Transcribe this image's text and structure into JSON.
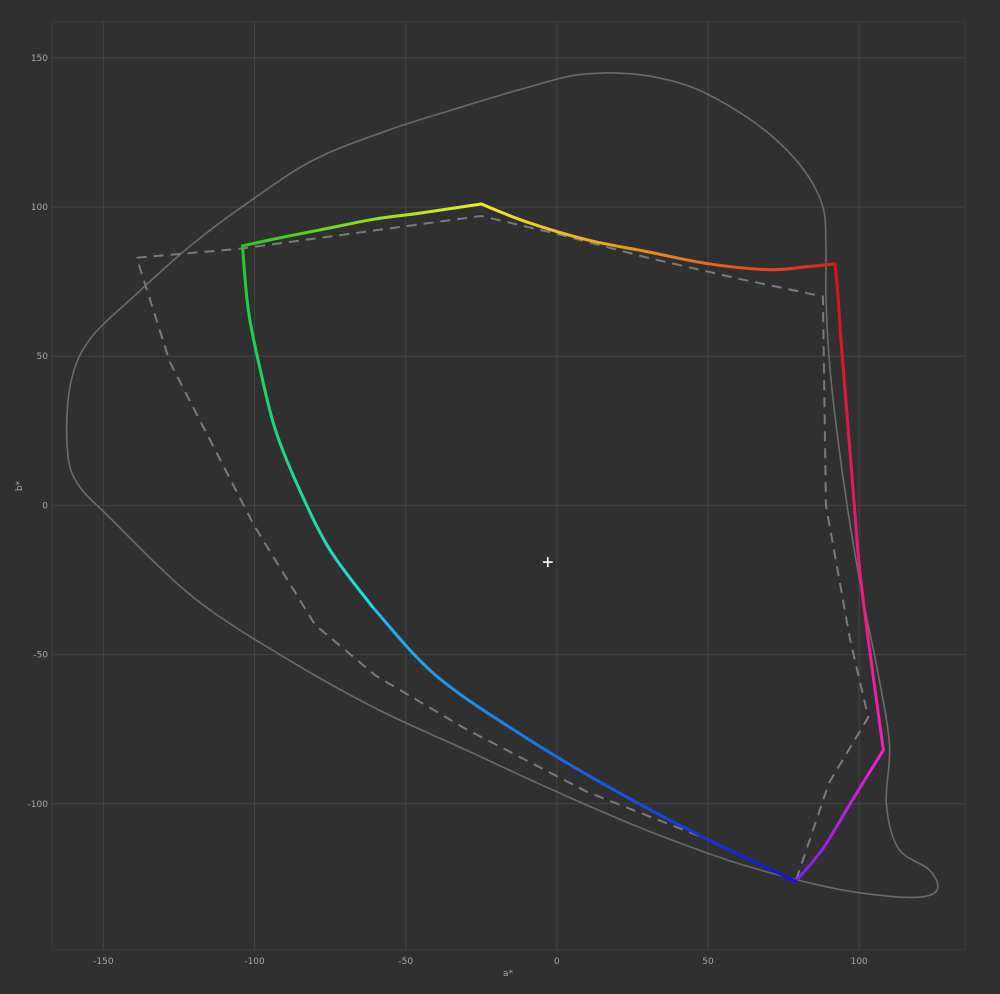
{
  "chart_data": {
    "type": "line",
    "xlabel": "a*",
    "ylabel": "b*",
    "xlim": [
      -167,
      135
    ],
    "ylim": [
      -149,
      162
    ],
    "xticks": [
      -150,
      -100,
      -50,
      0,
      50,
      100
    ],
    "yticks": [
      -100,
      -50,
      0,
      50,
      100,
      150
    ],
    "grid": true,
    "series": [
      {
        "style": "solid-thin-gray",
        "color": "#6b6b6b",
        "closed": true,
        "points": [
          [
            17,
            145
          ],
          [
            30,
            144
          ],
          [
            45,
            140
          ],
          [
            60,
            132
          ],
          [
            72,
            123
          ],
          [
            82,
            112
          ],
          [
            88,
            100
          ],
          [
            89,
            87
          ],
          [
            89,
            70
          ],
          [
            90,
            50
          ],
          [
            92,
            30
          ],
          [
            96,
            0
          ],
          [
            101,
            -30
          ],
          [
            106,
            -55
          ],
          [
            110,
            -80
          ],
          [
            109,
            -100
          ],
          [
            113,
            -115
          ],
          [
            123,
            -122
          ],
          [
            126,
            -128
          ],
          [
            122,
            -131
          ],
          [
            110,
            -131
          ],
          [
            90,
            -128
          ],
          [
            60,
            -120
          ],
          [
            30,
            -109
          ],
          [
            0,
            -96
          ],
          [
            -30,
            -82
          ],
          [
            -60,
            -68
          ],
          [
            -90,
            -51
          ],
          [
            -120,
            -31
          ],
          [
            -148,
            -4
          ],
          [
            -159,
            8
          ],
          [
            -162,
            20
          ],
          [
            -161,
            40
          ],
          [
            -155,
            55
          ],
          [
            -140,
            70
          ],
          [
            -120,
            88
          ],
          [
            -100,
            103
          ],
          [
            -80,
            116
          ],
          [
            -55,
            126
          ],
          [
            -30,
            134
          ],
          [
            -10,
            140
          ],
          [
            5,
            144
          ],
          [
            17,
            145
          ]
        ]
      },
      {
        "style": "dashed-gray",
        "color": "#7a7a7a",
        "closed": true,
        "points": [
          [
            -139,
            83
          ],
          [
            -105,
            86
          ],
          [
            -25,
            97
          ],
          [
            0,
            91
          ],
          [
            30,
            83
          ],
          [
            60,
            76
          ],
          [
            88,
            70
          ],
          [
            89,
            0
          ],
          [
            97,
            -45
          ],
          [
            103,
            -71
          ],
          [
            90,
            -93
          ],
          [
            79,
            -126
          ],
          [
            50,
            -112
          ],
          [
            10,
            -96
          ],
          [
            -30,
            -75
          ],
          [
            -60,
            -57
          ],
          [
            -80,
            -40
          ],
          [
            -100,
            -7
          ],
          [
            -128,
            48
          ],
          [
            -139,
            83
          ]
        ]
      },
      {
        "style": "solid-gradient",
        "closed": true,
        "segments": [
          {
            "from": "#22cc22",
            "to": "#eeee22",
            "points": [
              [
                -104,
                87
              ],
              [
                -90,
                90
              ],
              [
                -75,
                93
              ],
              [
                -60,
                96
              ],
              [
                -45,
                98
              ],
              [
                -25,
                101
              ]
            ]
          },
          {
            "from": "#eeee22",
            "to": "#dd2222",
            "points": [
              [
                -25,
                101
              ],
              [
                -10,
                95
              ],
              [
                10,
                89
              ],
              [
                30,
                85
              ],
              [
                50,
                81
              ],
              [
                70,
                79
              ],
              [
                83,
                80
              ],
              [
                92,
                81
              ]
            ]
          },
          {
            "from": "#dd1111",
            "to": "#ee22bb",
            "points": [
              [
                92,
                81
              ],
              [
                93,
                70
              ],
              [
                94,
                55
              ],
              [
                96,
                30
              ],
              [
                98,
                5
              ],
              [
                100,
                -20
              ],
              [
                103,
                -45
              ],
              [
                108,
                -82
              ]
            ]
          },
          {
            "from": "#ee22cc",
            "to": "#7722ee",
            "points": [
              [
                108,
                -82
              ],
              [
                97,
                -100
              ],
              [
                88,
                -115
              ],
              [
                79,
                -126
              ]
            ]
          },
          {
            "from": "#1111dd",
            "to": "#22bbee",
            "points": [
              [
                79,
                -126
              ],
              [
                50,
                -112
              ],
              [
                20,
                -96
              ],
              [
                -10,
                -78
              ],
              [
                -40,
                -57
              ],
              [
                -61,
                -34
              ]
            ]
          },
          {
            "from": "#22dddd",
            "to": "#22cc22",
            "points": [
              [
                -61,
                -34
              ],
              [
                -75,
                -15
              ],
              [
                -85,
                5
              ],
              [
                -93,
                25
              ],
              [
                -98,
                45
              ],
              [
                -102,
                65
              ],
              [
                -104,
                87
              ]
            ]
          }
        ]
      }
    ],
    "whitepoint": {
      "a": -3,
      "b": -19,
      "color": "#ffffff"
    }
  }
}
